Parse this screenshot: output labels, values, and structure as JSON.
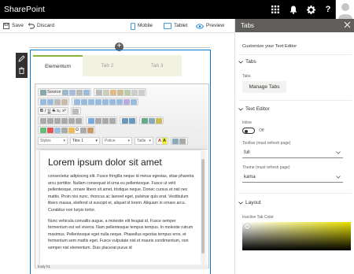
{
  "suite": {
    "title": "SharePoint",
    "icons": [
      "app-launcher-icon",
      "bell-icon",
      "gear-icon",
      "help-icon",
      "avatar"
    ]
  },
  "command_bar": {
    "save": "Save",
    "discard": "Discard",
    "mobile": "Mobile",
    "tablet": "Tablet",
    "preview": "Preview"
  },
  "tabs": [
    {
      "label": "Elementum",
      "active": true
    },
    {
      "label": "Tab 2",
      "active": false
    },
    {
      "label": "Tab 3",
      "active": false
    }
  ],
  "editor": {
    "source_label": "Source",
    "styles_placeholder": "Styles",
    "format_value": "Titre 1",
    "font_placeholder": "Police",
    "size_placeholder": "Taille",
    "heading": "Lorem ipsum dolor sit amet",
    "paragraph1": "consectetur adipiscing elit. Fusce fringilla neque id metus egestas, vitae pharetra arcu porttitor. Nullam consequat id urna eu pellentesque. Fusce ut velit pellentesque, ornare libero sit amet, tristique neque. Donec cursus et nisl nec mattis. Proin nisi nunc, rhoncus ac laoreet eget, pulvinar quis erat. Vestibulum libero massa, eleifend ut suscipit et, aliquet id lorem. Aliquam in ornare arcu. Curabitur non turpis tortor.",
    "paragraph2": "Nunc vehicula convallis augue, a molestie elit feugiat id. Fusce semper fermentum est vel viverra. Nam pellentesque tempus tempus. In molestie rutrum maximus. Pellentesque eget nulla neque. Phasellus egestas tempus eros, et fermentum sem mattis eget. Fusce vulputate nisl et mauris condimentum, non semper nisl elementum. Duis placerat purus id",
    "status": "body  h1"
  },
  "panel": {
    "title": "Tabs",
    "subtitle": "Customize your Text Editor",
    "section_tabs": "Tabs",
    "tabs_label": "Tabs",
    "manage_tabs": "Manage Tabs",
    "section_text_editor": "Text Editor",
    "inline_label": "Inline",
    "inline_value": "Off",
    "toolbar_label": "Toolbar (must refresh page)",
    "toolbar_value": "full",
    "theme_label": "Theme (must refresh page)",
    "theme_value": "kama",
    "section_layout": "Layout",
    "inactive_color_label": "Inactive Tab Color"
  },
  "colors": {
    "accent": "#0078d4",
    "active_tab_border": "#8bb33a",
    "inactive_tab_bg": "#f3f2e1",
    "panel_header": "#605e5c"
  }
}
